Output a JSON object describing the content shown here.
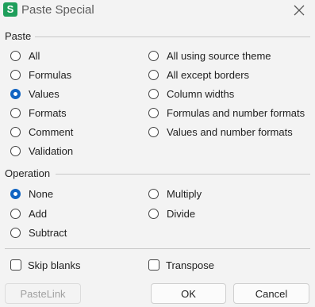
{
  "window": {
    "app_icon_letter": "S",
    "title": "Paste Special",
    "close_icon": "close-icon"
  },
  "paste": {
    "label": "Paste",
    "left_options": [
      {
        "label": "All",
        "checked": false
      },
      {
        "label": "Formulas",
        "checked": false
      },
      {
        "label": "Values",
        "checked": true
      },
      {
        "label": "Formats",
        "checked": false
      },
      {
        "label": "Comment",
        "checked": false
      },
      {
        "label": "Validation",
        "checked": false
      }
    ],
    "right_options": [
      {
        "label": "All using source theme",
        "checked": false
      },
      {
        "label": "All except borders",
        "checked": false
      },
      {
        "label": "Column widths",
        "checked": false
      },
      {
        "label": "Formulas and number formats",
        "checked": false
      },
      {
        "label": "Values and number formats",
        "checked": false
      }
    ]
  },
  "operation": {
    "label": "Operation",
    "left_options": [
      {
        "label": "None",
        "checked": true
      },
      {
        "label": "Add",
        "checked": false
      },
      {
        "label": "Subtract",
        "checked": false
      }
    ],
    "right_options": [
      {
        "label": "Multiply",
        "checked": false
      },
      {
        "label": "Divide",
        "checked": false
      }
    ]
  },
  "checkboxes": [
    {
      "label": "Skip blanks",
      "checked": false
    },
    {
      "label": "Transpose",
      "checked": false
    }
  ],
  "buttons": {
    "paste_link": "PasteLink",
    "ok": "OK",
    "cancel": "Cancel"
  },
  "colors": {
    "accent": "#1164c2",
    "app_icon": "#1e9e5a"
  }
}
